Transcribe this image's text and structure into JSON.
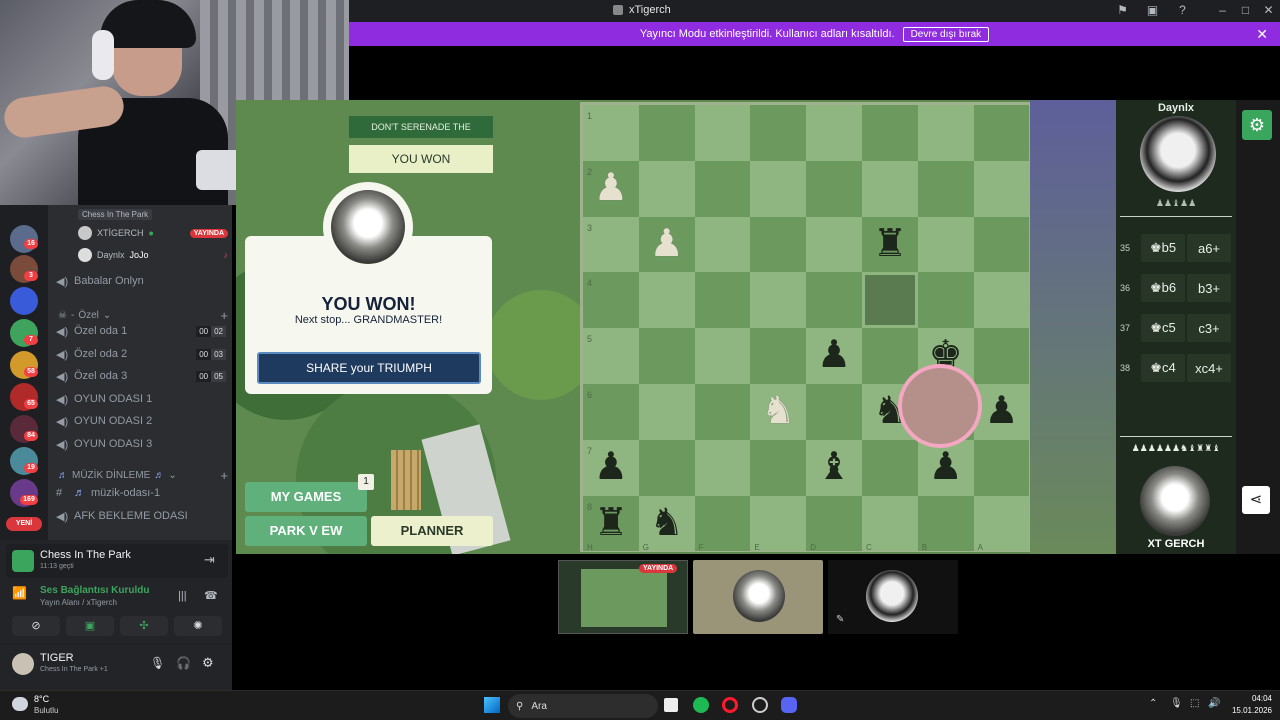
{
  "window": {
    "title": "xTigerch"
  },
  "banner": {
    "text": "Yayıncı Modu etkinleştirildi. Kullanıcı adları kısaltıldı.",
    "button": "Devre dışı bırak"
  },
  "server": {
    "event_label": "Chess In The Park",
    "guild_badges": [
      "16",
      "3",
      "7",
      "58",
      "65",
      "84",
      "19",
      "169"
    ],
    "new_badge": "YENİ",
    "voice_users": [
      {
        "name": "XTİGERCH",
        "badge": "YAYINDA"
      },
      {
        "name": "Daynlx",
        "status": "JoJo"
      }
    ],
    "channels_top": [
      {
        "name": "Babalar Onlyn"
      }
    ],
    "category_ozel": "Özel",
    "ozel_channels": [
      {
        "name": "Özel oda 1",
        "a": "00",
        "b": "02"
      },
      {
        "name": "Özel oda 2",
        "a": "00",
        "b": "03"
      },
      {
        "name": "Özel oda 3",
        "a": "00",
        "b": "05"
      },
      {
        "name": "OYUN ODASI 1"
      },
      {
        "name": "OYUN ODASI 2"
      },
      {
        "name": "OYUN ODASI 3"
      }
    ],
    "category_music": "MÜZİK DİNLEME",
    "music_channels": [
      {
        "name": "müzik-odası-1"
      },
      {
        "name": "AFK BEKLEME ODASI"
      }
    ]
  },
  "activity": {
    "title": "Chess In The Park",
    "sub": "11:13 geçti"
  },
  "voice": {
    "status": "Ses Bağlantısı Kuruldu",
    "sub": "Yayın Alanı",
    "sub2": "/ xTigerch"
  },
  "me": {
    "name": "TIGER",
    "sub": "Chess In The Park",
    "extra": "+1"
  },
  "game": {
    "quest": "DON'T SERENADE THE FORTRESS",
    "quest_result": "YOU WON",
    "won_title": "YOU WON!",
    "won_sub": "Next stop... GRANDMASTER!",
    "share": "SHARE your TRIUMPH",
    "my_games": "MY GAMES",
    "my_games_count": "1",
    "park_view": "PARK V EW",
    "planner": "PLANNER",
    "ranks": [
      "1",
      "2",
      "3",
      "4",
      "5",
      "6",
      "7",
      "8"
    ],
    "files": [
      "H",
      "G",
      "F",
      "E",
      "D",
      "C",
      "B",
      "A"
    ],
    "opponent": "Daynlx",
    "player": "XT GERCH",
    "moves": [
      {
        "n": "35",
        "a": "♚b5",
        "b": "a6+"
      },
      {
        "n": "36",
        "a": "♚b6",
        "b": "b3+"
      },
      {
        "n": "37",
        "a": "♚c5",
        "b": "c3+"
      },
      {
        "n": "38",
        "a": "♚c4",
        "b": "xc4+"
      }
    ],
    "captured_top": "♟♟♝♟♟",
    "captured_bottom": "♟♟♟♟♟♟♞♝♜♜♝"
  },
  "stream": {
    "live": "YAYINDA"
  },
  "taskbar": {
    "weather_temp": "8°C",
    "weather_desc": "Bulutlu",
    "search": "Ara",
    "time": "04:04",
    "date": "15.01.2026"
  }
}
